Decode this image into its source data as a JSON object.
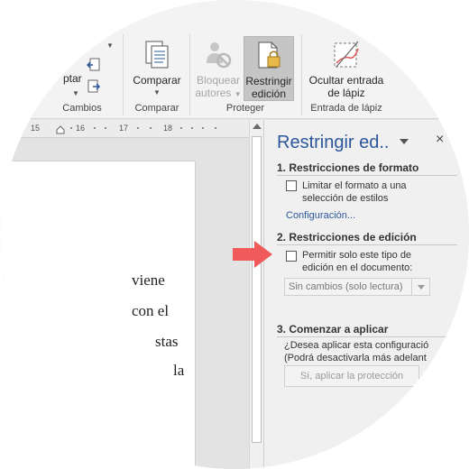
{
  "ribbon": {
    "cambios": {
      "aceptar_partial": "ptar",
      "group_label": "Cambios"
    },
    "comparar": {
      "button_label": "Comparar",
      "group_label": "Comparar"
    },
    "proteger": {
      "bloquear_line1": "Bloquear",
      "bloquear_line2": "autores",
      "restringir_line1": "Restringir",
      "restringir_line2": "edición",
      "group_label": "Proteger"
    },
    "lapiz": {
      "ocultar_line1": "Ocultar entrada",
      "ocultar_line2": "de lápiz",
      "group_label": "Entrada de lápiz"
    }
  },
  "ruler": {
    "numbers": [
      "15",
      "16",
      "17",
      "18"
    ]
  },
  "document": {
    "lines": [
      "viene",
      "con  el",
      "stas",
      "la"
    ]
  },
  "pane": {
    "title": "Restringir ed..",
    "close": "×",
    "section1": {
      "heading": "1. Restricciones de formato",
      "checkbox_line1": "Limitar el formato a una",
      "checkbox_line2": "selección de estilos",
      "link": "Configuración..."
    },
    "section2": {
      "heading": "2. Restricciones de edición",
      "checkbox_line1": "Permitir solo este tipo de",
      "checkbox_line2": "edición en el documento:",
      "dropdown_value": "Sin cambios (solo lectura)"
    },
    "section3": {
      "heading": "3. Comenzar a aplicar",
      "question_line1": "¿Desea aplicar esta configuració",
      "question_line2": "(Podrá desactivarla más adelant",
      "apply_button": "Sí, aplicar la protección"
    }
  },
  "colors": {
    "accent": "#2b579a",
    "arrow": "#f05a5a"
  }
}
